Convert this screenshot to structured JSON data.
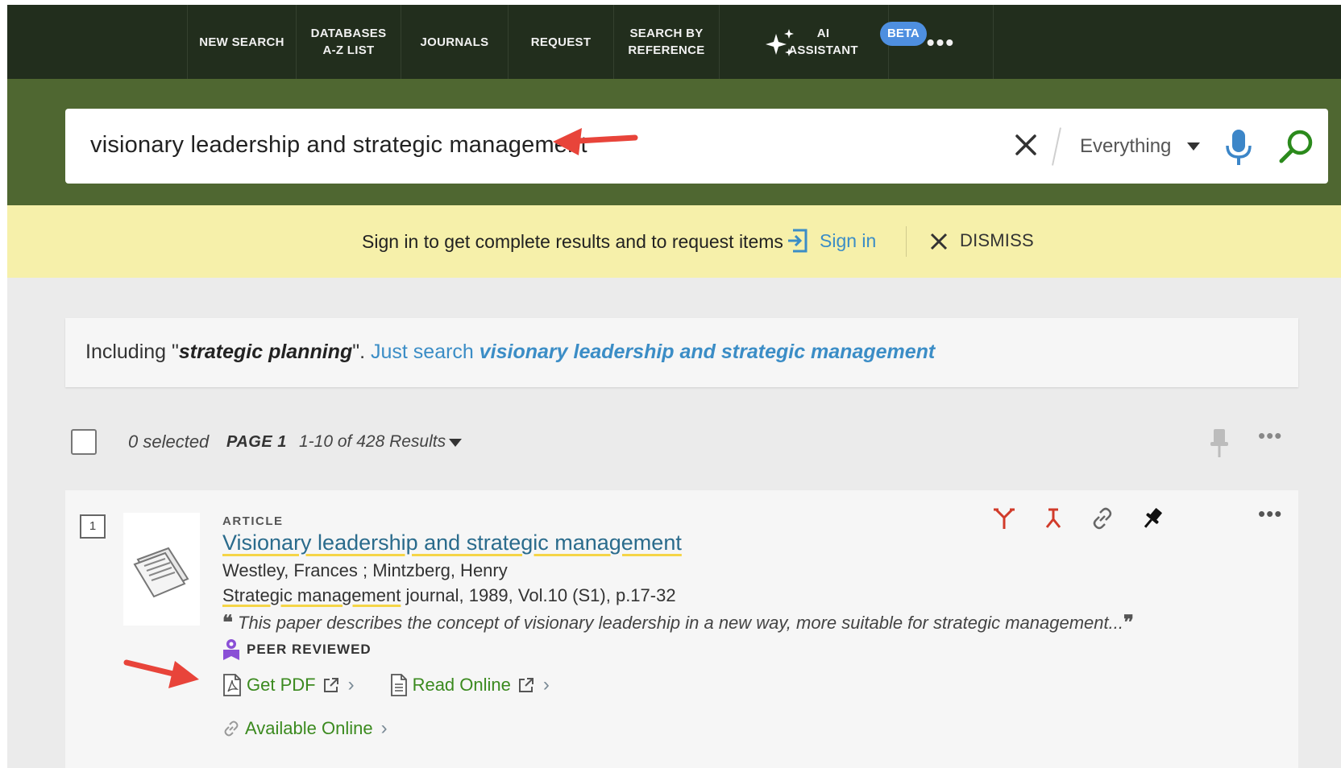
{
  "nav": {
    "items": [
      {
        "label": "NEW SEARCH"
      },
      {
        "label": "DATABASES\nA-Z LIST"
      },
      {
        "label": "JOURNALS"
      },
      {
        "label": "REQUEST"
      },
      {
        "label": "SEARCH BY\nREFERENCE"
      },
      {
        "label": "AI\nASSISTANT"
      }
    ],
    "beta_badge": "BETA",
    "more_icon": "more-horizontal-icon"
  },
  "search": {
    "query": "visionary leadership and strategic management",
    "scope": "Everything",
    "icons": [
      "close-icon",
      "microphone-icon",
      "search-icon"
    ]
  },
  "signin": {
    "message": "Sign in to get complete results and to request items",
    "link": "Sign in",
    "dismiss": "DISMISS"
  },
  "including": {
    "prefix": "Including \"",
    "term": "strategic planning",
    "suffix": "\". ",
    "just_search": "Just search ",
    "original_query": "visionary leadership and strategic management"
  },
  "results_toolbar": {
    "selected": "0 selected",
    "page": "PAGE 1",
    "range": "1-10 of 428 Results"
  },
  "result": {
    "index": "1",
    "type": "ARTICLE",
    "title": "Visionary leadership and strategic management",
    "authors": "Westley, Frances ; Mintzberg, Henry",
    "source_title": "Strategic management",
    "source_rest": " journal, 1989, Vol.10 (S1), p.17-32",
    "snippet": "This paper describes the concept of visionary leadership in a new way, more suitable for strategic management...",
    "peer_reviewed": "PEER REVIEWED",
    "get_pdf": "Get PDF",
    "read_online": "Read Online",
    "available_online": "Available Online"
  },
  "colors": {
    "nav_bg": "#222e1d",
    "search_band": "#4f6731",
    "signin_band": "#f6f0aa",
    "link_blue": "#3b8dc6",
    "action_green": "#3b8a1f",
    "arrow_red": "#e8443a"
  }
}
